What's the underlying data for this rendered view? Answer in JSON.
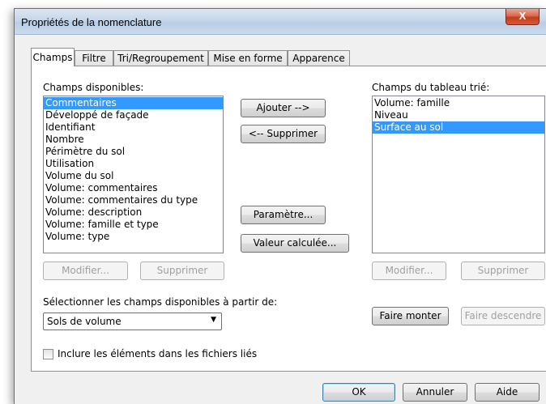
{
  "window": {
    "title": "Propriétés de la nomenclature",
    "close_label": "X"
  },
  "tabs": [
    {
      "label": "Champs",
      "active": true
    },
    {
      "label": "Filtre"
    },
    {
      "label": "Tri/Regroupement"
    },
    {
      "label": "Mise en forme"
    },
    {
      "label": "Apparence"
    }
  ],
  "available": {
    "label": "Champs disponibles:",
    "items": [
      "Commentaires",
      "Développé de façade",
      "Identifiant",
      "Nombre",
      "Périmètre du sol",
      "Utilisation",
      "Volume du sol",
      "Volume: commentaires",
      "Volume: commentaires du type",
      "Volume: description",
      "Volume: famille et type",
      "Volume: type"
    ],
    "selected_index": 0,
    "modify_label": "Modifier...",
    "delete_label": "Supprimer"
  },
  "middle": {
    "add_label": "Ajouter -->",
    "remove_label": "<-- Supprimer",
    "parameter_label": "Paramètre...",
    "calculated_label": "Valeur calculée..."
  },
  "scheduled": {
    "label": "Champs du tableau trié:",
    "items": [
      "Volume: famille",
      "Niveau",
      "Surface au sol"
    ],
    "selected_index": 2,
    "modify_label": "Modifier...",
    "delete_label": "Supprimer",
    "move_up_label": "Faire monter",
    "move_down_label": "Faire descendre"
  },
  "source": {
    "label": "Sélectionner les champs disponibles à partir de:",
    "selected": "Sols de volume"
  },
  "linked": {
    "label": "Inclure les éléments dans les fichiers liés",
    "checked": false
  },
  "footer": {
    "ok_label": "OK",
    "cancel_label": "Annuler",
    "help_label": "Aide"
  },
  "colors": {
    "selection": "#3399ff",
    "dialog_bg": "#f0f0f0",
    "close": "#c43c1c"
  }
}
